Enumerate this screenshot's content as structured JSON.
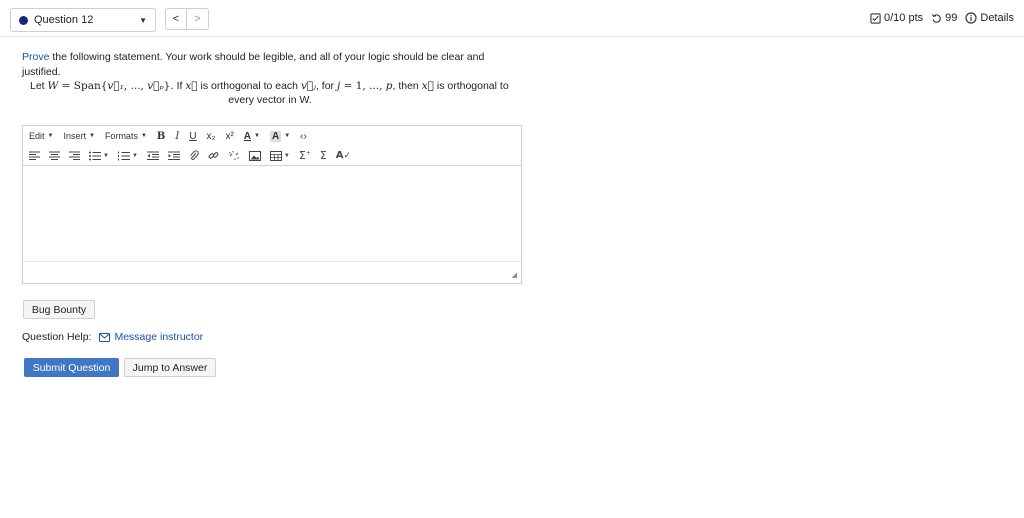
{
  "question_nav": {
    "label": "Question 12",
    "prev_glyph": "<",
    "next_glyph": ">"
  },
  "score_info": {
    "points": "0/10 pts",
    "attempts": "99",
    "details_label": "Details"
  },
  "question": {
    "prompt_prefix": "Prove",
    "prompt_rest": " the following statement. Your work should be legible, and all of your logic should be clear and justified.",
    "stmt_let": "Let ",
    "stmt_W": "W",
    "stmt_eq_span": " = Span{",
    "stmt_v1": "v⃗₁",
    "stmt_ellipsis": ", ..., ",
    "stmt_vp": "v⃗ₚ",
    "stmt_close": "}.",
    "stmt_if": " If ",
    "stmt_x": "x⃗",
    "stmt_ortho_each": " is orthogonal to each ",
    "stmt_vj": "v⃗ⱼ",
    "stmt_for": ", for ",
    "stmt_j": "j",
    "stmt_range": " = 1, ..., ",
    "stmt_p": "p",
    "stmt_then": ", then ",
    "stmt_x2": "x⃗",
    "stmt_ortho_to": " is orthogonal to",
    "stmt_every": "every vector in ",
    "stmt_W2": "W",
    "stmt_period": "."
  },
  "editor": {
    "menus": [
      "Edit",
      "Insert",
      "Formats"
    ],
    "format_buttons": [
      "B",
      "I",
      "U",
      "x₂",
      "x²"
    ]
  },
  "buttons": {
    "bug_bounty": "Bug Bounty",
    "submit": "Submit Question",
    "jump": "Jump to Answer"
  },
  "help": {
    "label": "Question Help:",
    "message_link": "Message instructor"
  },
  "colors": {
    "accent_blue": "#3f77c4",
    "link_blue": "#1a4fa3",
    "nav_dot": "#1a237e"
  }
}
